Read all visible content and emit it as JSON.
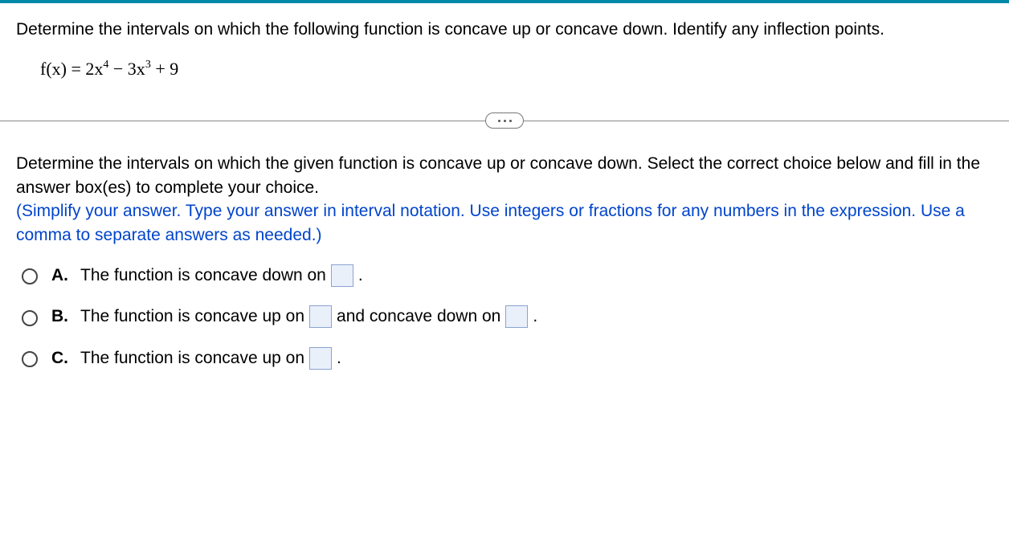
{
  "question": {
    "prompt": "Determine the intervals on which the following function is concave up or concave down. Identify any inflection points.",
    "formula_prefix": "f(x) = 2x",
    "formula_exp1": "4",
    "formula_mid": " − 3x",
    "formula_exp2": "3",
    "formula_suffix": " + 9"
  },
  "instructions": {
    "line1": "Determine the intervals on which the given function is concave up or concave down. Select the correct choice below and fill in the answer box(es) to complete your choice.",
    "hint": "(Simplify your answer. Type your answer in interval notation. Use integers or fractions for any numbers in the expression. Use a comma to separate answers as needed.)"
  },
  "choices": {
    "A": {
      "letter": "A.",
      "text1": "The function is concave down on",
      "period": "."
    },
    "B": {
      "letter": "B.",
      "text1": "The function is concave up on",
      "text2": "and concave down on",
      "period": "."
    },
    "C": {
      "letter": "C.",
      "text1": "The function is concave up on",
      "period": "."
    }
  }
}
